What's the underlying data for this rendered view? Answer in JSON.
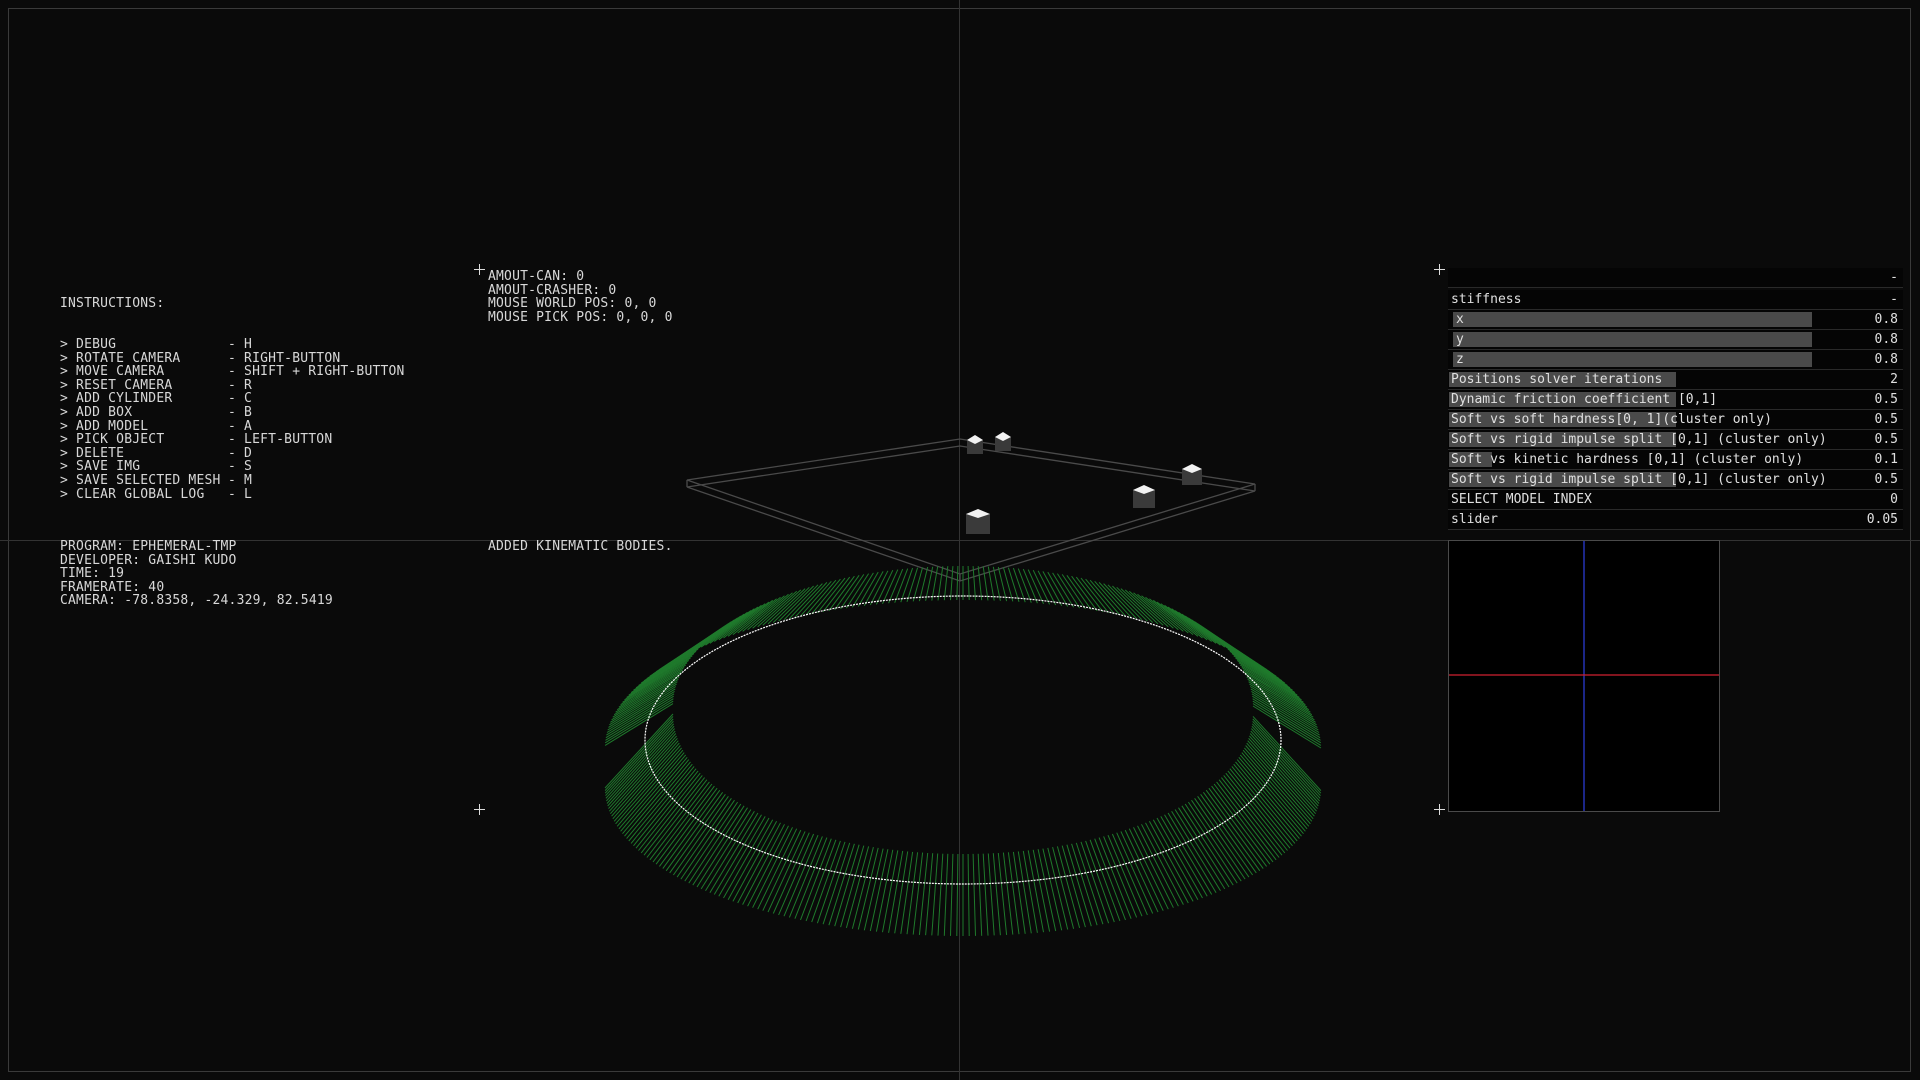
{
  "instructions": {
    "title": "INSTRUCTIONS:",
    "items": [
      {
        "action": "> DEBUG",
        "key": "- H"
      },
      {
        "action": "> ROTATE CAMERA",
        "key": "- RIGHT-BUTTON"
      },
      {
        "action": "> MOVE CAMERA",
        "key": "- SHIFT + RIGHT-BUTTON"
      },
      {
        "action": "> RESET CAMERA",
        "key": "- R"
      },
      {
        "action": "> ADD CYLINDER",
        "key": "- C"
      },
      {
        "action": "> ADD BOX",
        "key": "- B"
      },
      {
        "action": "> ADD MODEL",
        "key": "- A"
      },
      {
        "action": "> PICK OBJECT",
        "key": "- LEFT-BUTTON"
      },
      {
        "action": "> DELETE",
        "key": "- D"
      },
      {
        "action": "> SAVE IMG",
        "key": "- S"
      },
      {
        "action": "> SAVE SELECTED MESH",
        "key": "- M"
      },
      {
        "action": "> CLEAR GLOBAL LOG",
        "key": "- L"
      }
    ]
  },
  "status": {
    "lines": [
      "AMOUT-CAN: 0",
      "AMOUT-CRASHER: 0",
      "MOUSE WORLD POS: 0, 0",
      "MOUSE PICK POS: 0, 0, 0"
    ]
  },
  "program_info": {
    "lines": [
      "PROGRAM: EPHEMERAL-TMP",
      "DEVELOPER: GAISHI KUDO",
      "TIME: 19",
      "FRAMERATE: 40",
      "CAMERA: -78.8358, -24.329, 82.5419"
    ]
  },
  "log": {
    "message": "ADDED KINEMATIC BODIES."
  },
  "panel": {
    "header_toggle": "-",
    "stiffness": {
      "label": "stiffness",
      "toggle": "-"
    },
    "x": {
      "label": "x",
      "value": "0.8",
      "fraction": 0.8
    },
    "y": {
      "label": "y",
      "value": "0.8",
      "fraction": 0.8
    },
    "z": {
      "label": "z",
      "value": "0.8",
      "fraction": 0.8
    },
    "positions_solver": {
      "label": "Positions solver iterations",
      "value": "2"
    },
    "dynamic_friction": {
      "label": "Dynamic friction coefficient [0,1]",
      "value": "0.5"
    },
    "soft_soft_hardness": {
      "label": "Soft vs soft hardness[0, 1](cluster only)",
      "value": "0.5"
    },
    "soft_rigid_impulse": {
      "label": "Soft vs rigid impulse split [0,1] (cluster only)",
      "value": "0.5"
    },
    "soft_kinetic_hardness": {
      "label": "Soft vs kinetic hardness [0,1] (cluster only)",
      "value": "0.1"
    },
    "soft_rigid_impulse_2": {
      "label": "Soft vs rigid impulse split [0,1] (cluster only)",
      "value": "0.5"
    },
    "select_model_index": {
      "label": "SELECT MODEL INDEX",
      "value": "0"
    },
    "slider": {
      "label": "slider",
      "value": "0.05"
    }
  },
  "colors": {
    "ring": "#1f7a2c",
    "ring_line": "#ffffff",
    "axis_x": "#d02030",
    "axis_y": "#2a3ad0"
  },
  "icons": [
    "crosshair-icon"
  ]
}
